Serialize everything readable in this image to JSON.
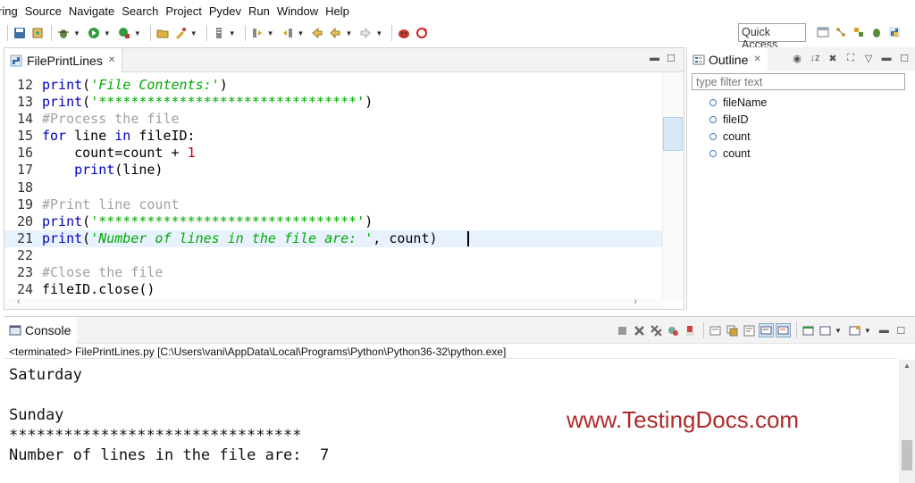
{
  "menu": [
    "ring",
    "Source",
    "Navigate",
    "Search",
    "Project",
    "Pydev",
    "Run",
    "Window",
    "Help"
  ],
  "toolbar": {
    "quick_access": "Quick Access",
    "icons": [
      "save-icon",
      "new-icon",
      "debug-icon",
      "run-icon",
      "external-tools-icon",
      "open-folder-icon",
      "open-type-icon",
      "search-icon",
      "annotation-icon",
      "back-icon",
      "forward-icon",
      "stop-icon",
      "refresh-icon"
    ]
  },
  "editor": {
    "tab_label": "FilePrintLines",
    "lines": [
      {
        "n": "12",
        "kind": "print_str",
        "fn": "print",
        "open": "(",
        "str": "'File Contents:'",
        "close": ")"
      },
      {
        "n": "13",
        "kind": "print_str",
        "fn": "print",
        "open": "(",
        "str": "'********************************'",
        "close": ")"
      },
      {
        "n": "14",
        "kind": "comment",
        "text": "#Process the file"
      },
      {
        "n": "15",
        "kind": "for",
        "kw1": "for",
        "mid1": " line ",
        "kw2": "in",
        "rest": " fileID:"
      },
      {
        "n": "16",
        "kind": "assign",
        "pre": "    count=count + ",
        "num": "1"
      },
      {
        "n": "17",
        "kind": "call",
        "indent": "    ",
        "fn": "print",
        "rest": "(line)"
      },
      {
        "n": "18",
        "kind": "blank"
      },
      {
        "n": "19",
        "kind": "comment",
        "text": "#Print line count"
      },
      {
        "n": "20",
        "kind": "print_str",
        "fn": "print",
        "open": "(",
        "str": "'********************************'",
        "close": ")"
      },
      {
        "n": "21",
        "kind": "print_str_count",
        "fn": "print",
        "open": "(",
        "str": "'Number of lines in the file are: '",
        "close": ", count)"
      },
      {
        "n": "22",
        "kind": "blank"
      },
      {
        "n": "23",
        "kind": "comment",
        "text": "#Close the file"
      },
      {
        "n": "24",
        "kind": "plain",
        "text": "fileID.close()"
      }
    ]
  },
  "outline": {
    "tab_label": "Outline",
    "filter_placeholder": "type filter text",
    "items": [
      "fileName",
      "fileID",
      "count",
      "count"
    ]
  },
  "console": {
    "tab_label": "Console",
    "terminated": "<terminated> FilePrintLines.py [C:\\Users\\vani\\AppData\\Local\\Programs\\Python\\Python36-32\\python.exe]",
    "output": [
      "Saturday",
      "",
      "Sunday",
      "********************************",
      "Number of lines in the file are:  7"
    ],
    "watermark": "www.TestingDocs.com"
  },
  "colors": {
    "keyword": "#0000c0",
    "string": "#00aa00",
    "comment": "#a0a0a0",
    "number": "#c00000",
    "watermark": "#b02a2a",
    "current_line": "#e8f2fe"
  }
}
